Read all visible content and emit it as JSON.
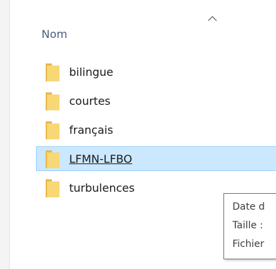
{
  "header": {
    "name_column_label": "Nom",
    "sort_direction_icon": "chevron-up-icon"
  },
  "files": {
    "items": [
      {
        "label": "bilingue",
        "icon": "folder-icon",
        "selected": false
      },
      {
        "label": "courtes",
        "icon": "folder-icon",
        "selected": false
      },
      {
        "label": "français",
        "icon": "folder-icon",
        "selected": false
      },
      {
        "label": "LFMN-LFBO",
        "icon": "folder-icon",
        "selected": true
      },
      {
        "label": "turbulences",
        "icon": "folder-icon",
        "selected": false
      }
    ]
  },
  "tooltip": {
    "lines": [
      "Date d",
      "Taille :",
      "Fichier"
    ]
  },
  "colors": {
    "folder_fill": "#f8d775",
    "folder_tab": "#e8b84a",
    "selection_background": "#cce8ff",
    "selection_border": "#99d1ff",
    "header_text": "#4b5e7e"
  }
}
